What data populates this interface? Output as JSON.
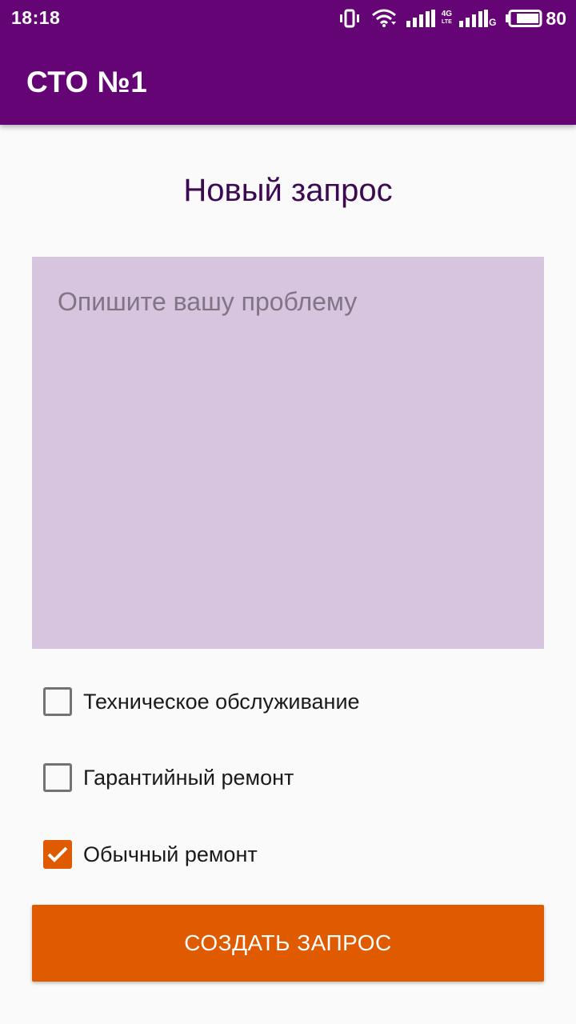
{
  "status_bar": {
    "time": "18:18",
    "network_type_top": "4G",
    "network_type_bottom": "LTE",
    "network_type_second": "G",
    "battery_level": "80",
    "icons": [
      "vibrate-icon",
      "wifi-icon",
      "signal-icon",
      "signal-icon",
      "battery-icon"
    ]
  },
  "app_bar": {
    "title": "СТО №1"
  },
  "form": {
    "heading": "Новый запрос",
    "description_placeholder": "Опишите вашу проблему",
    "description_value": "",
    "options": [
      {
        "label": "Техническое обслуживание",
        "checked": false
      },
      {
        "label": "Гарантийный ремонт",
        "checked": false
      },
      {
        "label": "Обычный ремонт",
        "checked": true
      }
    ],
    "submit_label": "СОЗДАТЬ ЗАПРОС"
  },
  "colors": {
    "app_bar": "#650575",
    "accent": "#e05a00",
    "text_area_background": "#d7c4de",
    "heading": "#3c0a50"
  }
}
